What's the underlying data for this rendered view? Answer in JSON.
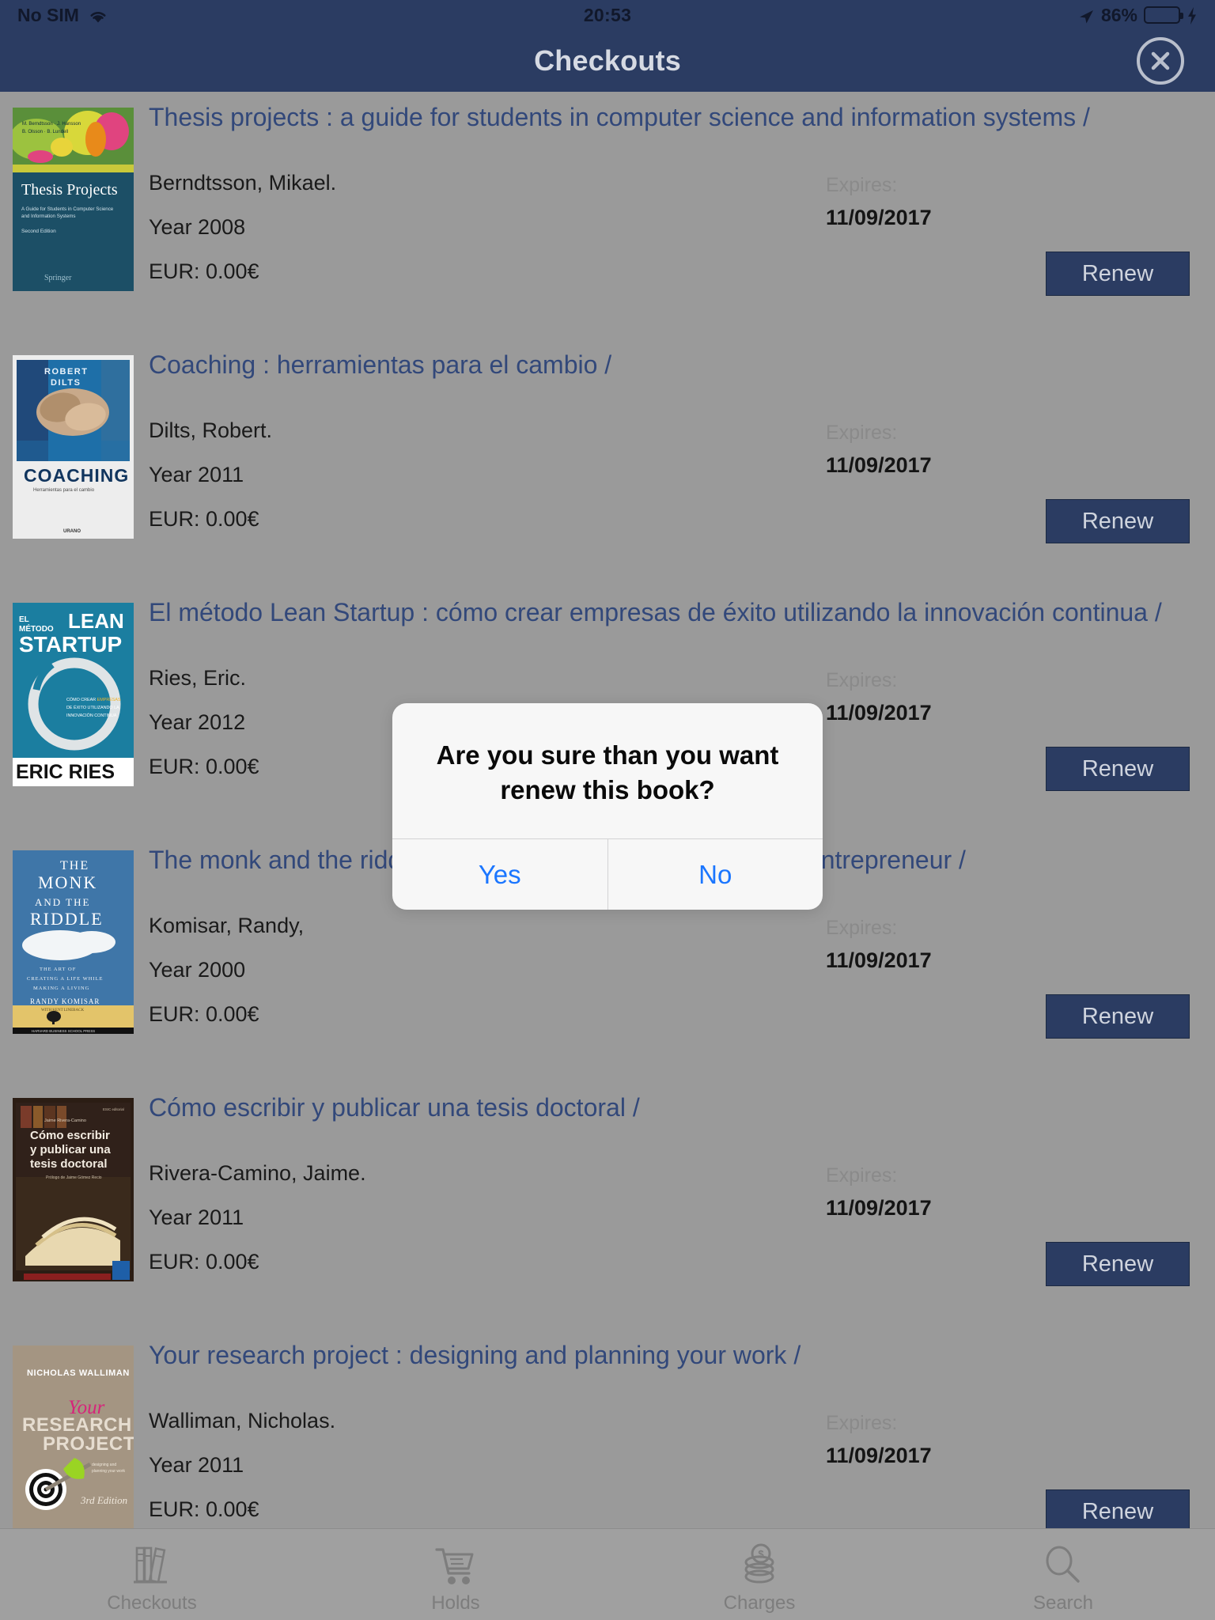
{
  "status_bar": {
    "carrier": "No SIM",
    "wifi_icon": "wifi-icon",
    "time": "20:53",
    "location_icon": "location-arrow-icon",
    "battery_percent": "86%",
    "battery_level": 86,
    "charging_icon": "lightning-bolt-icon"
  },
  "nav": {
    "title": "Checkouts",
    "close_icon": "close-circle-icon"
  },
  "colors": {
    "nav_background": "#2b3c62",
    "page_background": "#9a9a9a",
    "title_link": "#32487a",
    "renew_button": "#2b3c62",
    "alert_action": "#1b76ff",
    "battery_green": "#3ee04f"
  },
  "checkouts": {
    "expires_label": "Expires:",
    "renew_label": "Renew",
    "items": [
      {
        "title": "Thesis projects : a guide for students in computer science and information systems /",
        "author": "Berndtsson, Mikael.",
        "year": "Year 2008",
        "price": "EUR: 0.00€",
        "expires": "11/09/2017",
        "cover_name": "book-cover-thesis-projects",
        "cover_title": "Thesis Projects",
        "cover_subtitle": "A Guide for Students in Computer Science and Information Systems",
        "cover_edition": "Second Edition",
        "cover_authors": "M. Berndtsson · J. Hansson · B. Olsson · B. Lundell",
        "cover_publisher": "Springer"
      },
      {
        "title": "Coaching : herramientas para el cambio /",
        "author": "Dilts, Robert.",
        "year": "Year 2011",
        "price": "EUR: 0.00€",
        "expires": "11/09/2017",
        "cover_name": "book-cover-coaching",
        "cover_title": "COACHING",
        "cover_subtitle": "Herramientas para el cambio",
        "cover_edition": "",
        "cover_authors": "ROBERT DILTS",
        "cover_publisher": "Urano"
      },
      {
        "title": "El método Lean Startup : cómo crear empresas de éxito utilizando la innovación continua /",
        "author": "Ries, Eric.",
        "year": "Year 2012",
        "price": "EUR: 0.00€",
        "expires": "11/09/2017",
        "cover_name": "book-cover-lean-startup",
        "cover_title": "EL MÉTODO LEAN STARTUP",
        "cover_subtitle": "Cómo crear empresas de éxito utilizando la innovación continua",
        "cover_edition": "",
        "cover_authors": "ERIC RIES",
        "cover_publisher": ""
      },
      {
        "title": "The monk and the riddle : the education of a Silicon Valley entrepreneur /",
        "author": "Komisar, Randy,",
        "year": "Year 2000",
        "price": "EUR: 0.00€",
        "expires": "11/09/2017",
        "cover_name": "book-cover-monk-and-riddle",
        "cover_title": "THE MONK AND THE RIDDLE",
        "cover_subtitle": "The Art of Creating a Life While Making a Living",
        "cover_edition": "",
        "cover_authors": "RANDY KOMISAR with Kent Lineback",
        "cover_publisher": "HARVARD BUSINESS SCHOOL PRESS"
      },
      {
        "title": "Cómo escribir y publicar una tesis doctoral /",
        "author": "Rivera-Camino, Jaime.",
        "year": "Year 2011",
        "price": "EUR: 0.00€",
        "expires": "11/09/2017",
        "cover_name": "book-cover-como-escribir-tesis",
        "cover_title": "Cómo escribir y publicar una tesis doctoral",
        "cover_subtitle": "Prólogo de Jaime Gómez Recio",
        "cover_edition": "",
        "cover_authors": "Jaime Rivera-Camino",
        "cover_publisher": "ESIC"
      },
      {
        "title": "Your research project : designing and planning your work /",
        "author": "Walliman, Nicholas.",
        "year": "Year 2011",
        "price": "EUR: 0.00€",
        "expires": "11/09/2017",
        "cover_name": "book-cover-your-research-project",
        "cover_title": "Your RESEARCH PROJECT",
        "cover_subtitle": "Designing and Planning Your Work",
        "cover_edition": "3rd Edition",
        "cover_authors": "NICHOLAS WALLIMAN",
        "cover_publisher": ""
      }
    ]
  },
  "alert": {
    "message": "Are you sure than you want renew this book?",
    "yes_label": "Yes",
    "no_label": "No"
  },
  "tabbar": {
    "tabs": [
      {
        "label": "Checkouts",
        "icon": "books-icon"
      },
      {
        "label": "Holds",
        "icon": "shopping-cart-icon"
      },
      {
        "label": "Charges",
        "icon": "coins-icon"
      },
      {
        "label": "Search",
        "icon": "magnifier-icon"
      }
    ]
  }
}
